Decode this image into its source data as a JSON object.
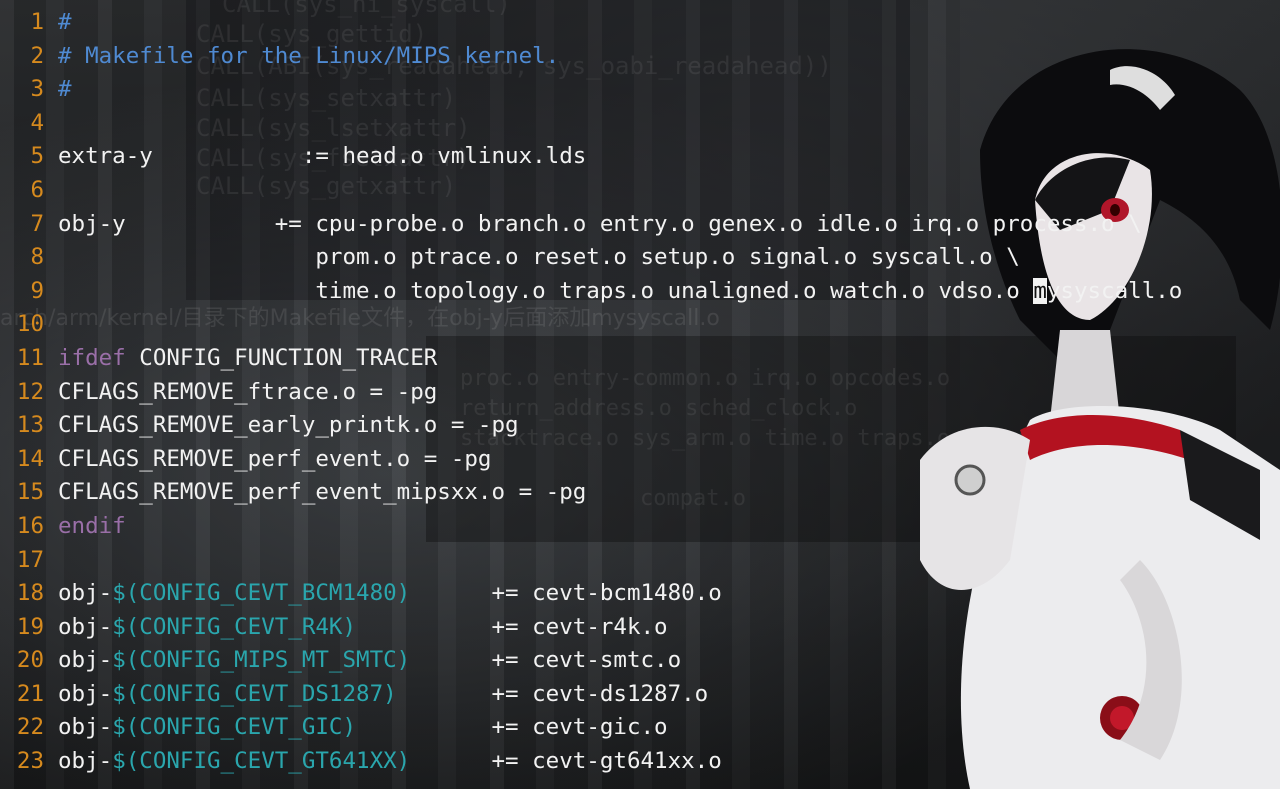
{
  "editor": {
    "lines": [
      {
        "n": "1",
        "segments": [
          {
            "t": "#",
            "c": "comment"
          }
        ]
      },
      {
        "n": "2",
        "segments": [
          {
            "t": "# Makefile for the Linux/MIPS kernel.",
            "c": "comment"
          }
        ]
      },
      {
        "n": "3",
        "segments": [
          {
            "t": "#",
            "c": "comment"
          }
        ]
      },
      {
        "n": "4",
        "segments": []
      },
      {
        "n": "5",
        "segments": [
          {
            "t": "extra-y           := head.o vmlinux.lds",
            "c": "plain"
          }
        ]
      },
      {
        "n": "6",
        "segments": []
      },
      {
        "n": "7",
        "segments": [
          {
            "t": "obj-y           += cpu-probe.o branch.o entry.o genex.o idle.o irq.o process.o \\",
            "c": "plain"
          }
        ]
      },
      {
        "n": "8",
        "segments": [
          {
            "t": "                   prom.o ptrace.o reset.o setup.o signal.o syscall.o \\",
            "c": "plain"
          }
        ]
      },
      {
        "n": "9",
        "segments": [
          {
            "t": "                   time.o topology.o traps.o unaligned.o watch.o vdso.o ",
            "c": "plain"
          },
          {
            "t": "m",
            "c": "cursor"
          },
          {
            "t": "ysyscall.o",
            "c": "plain"
          }
        ]
      },
      {
        "n": "10",
        "segments": []
      },
      {
        "n": "11",
        "segments": [
          {
            "t": "ifdef",
            "c": "kw"
          },
          {
            "t": " CONFIG_FUNCTION_TRACER",
            "c": "plain"
          }
        ]
      },
      {
        "n": "12",
        "segments": [
          {
            "t": "CFLAGS_REMOVE_ftrace.o = -pg",
            "c": "plain"
          }
        ]
      },
      {
        "n": "13",
        "segments": [
          {
            "t": "CFLAGS_REMOVE_early_printk.o = -pg",
            "c": "plain"
          }
        ]
      },
      {
        "n": "14",
        "segments": [
          {
            "t": "CFLAGS_REMOVE_perf_event.o = -pg",
            "c": "plain"
          }
        ]
      },
      {
        "n": "15",
        "segments": [
          {
            "t": "CFLAGS_REMOVE_perf_event_mipsxx.o = -pg",
            "c": "plain"
          }
        ]
      },
      {
        "n": "16",
        "segments": [
          {
            "t": "endif",
            "c": "kw"
          }
        ]
      },
      {
        "n": "17",
        "segments": []
      },
      {
        "n": "18",
        "segments": [
          {
            "t": "obj-",
            "c": "plain"
          },
          {
            "t": "$(CONFIG_CEVT_BCM1480)",
            "c": "var"
          },
          {
            "t": "      += cevt-bcm1480.o",
            "c": "plain"
          }
        ]
      },
      {
        "n": "19",
        "segments": [
          {
            "t": "obj-",
            "c": "plain"
          },
          {
            "t": "$(CONFIG_CEVT_R4K)",
            "c": "var"
          },
          {
            "t": "          += cevt-r4k.o",
            "c": "plain"
          }
        ]
      },
      {
        "n": "20",
        "segments": [
          {
            "t": "obj-",
            "c": "plain"
          },
          {
            "t": "$(CONFIG_MIPS_MT_SMTC)",
            "c": "var"
          },
          {
            "t": "      += cevt-smtc.o",
            "c": "plain"
          }
        ]
      },
      {
        "n": "21",
        "segments": [
          {
            "t": "obj-",
            "c": "plain"
          },
          {
            "t": "$(CONFIG_CEVT_DS1287)",
            "c": "var"
          },
          {
            "t": "       += cevt-ds1287.o",
            "c": "plain"
          }
        ]
      },
      {
        "n": "22",
        "segments": [
          {
            "t": "obj-",
            "c": "plain"
          },
          {
            "t": "$(CONFIG_CEVT_GIC)",
            "c": "var"
          },
          {
            "t": "          += cevt-gic.o",
            "c": "plain"
          }
        ]
      },
      {
        "n": "23",
        "segments": [
          {
            "t": "obj-",
            "c": "plain"
          },
          {
            "t": "$(CONFIG_CEVT_GT641XX)",
            "c": "var"
          },
          {
            "t": "      += cevt-gt641xx.o",
            "c": "plain"
          }
        ]
      }
    ]
  },
  "background": {
    "ghost_code": [
      "CALL(sys_ni_syscall)",
      "CALL(sys_gettid)",
      "CALL(ABI(sys_readahead, sys_oabi_readahead))",
      "CALL(sys_setxattr)",
      "CALL(sys_lsetxattr)",
      "CALL(sys_fsetxattr)",
      "CALL(sys_getxattr)",
      "proc.o entry-common.o irq.o opcodes.o",
      "return_address.o sched_clock.o",
      "stacktrace.o sys_arm.o time.o traps.o mysyscall.o",
      "compat.o"
    ],
    "ghost_caption": "arch/arm/kernel/目录下的Makefile文件，在obj-y后面添加mysyscall.o"
  }
}
